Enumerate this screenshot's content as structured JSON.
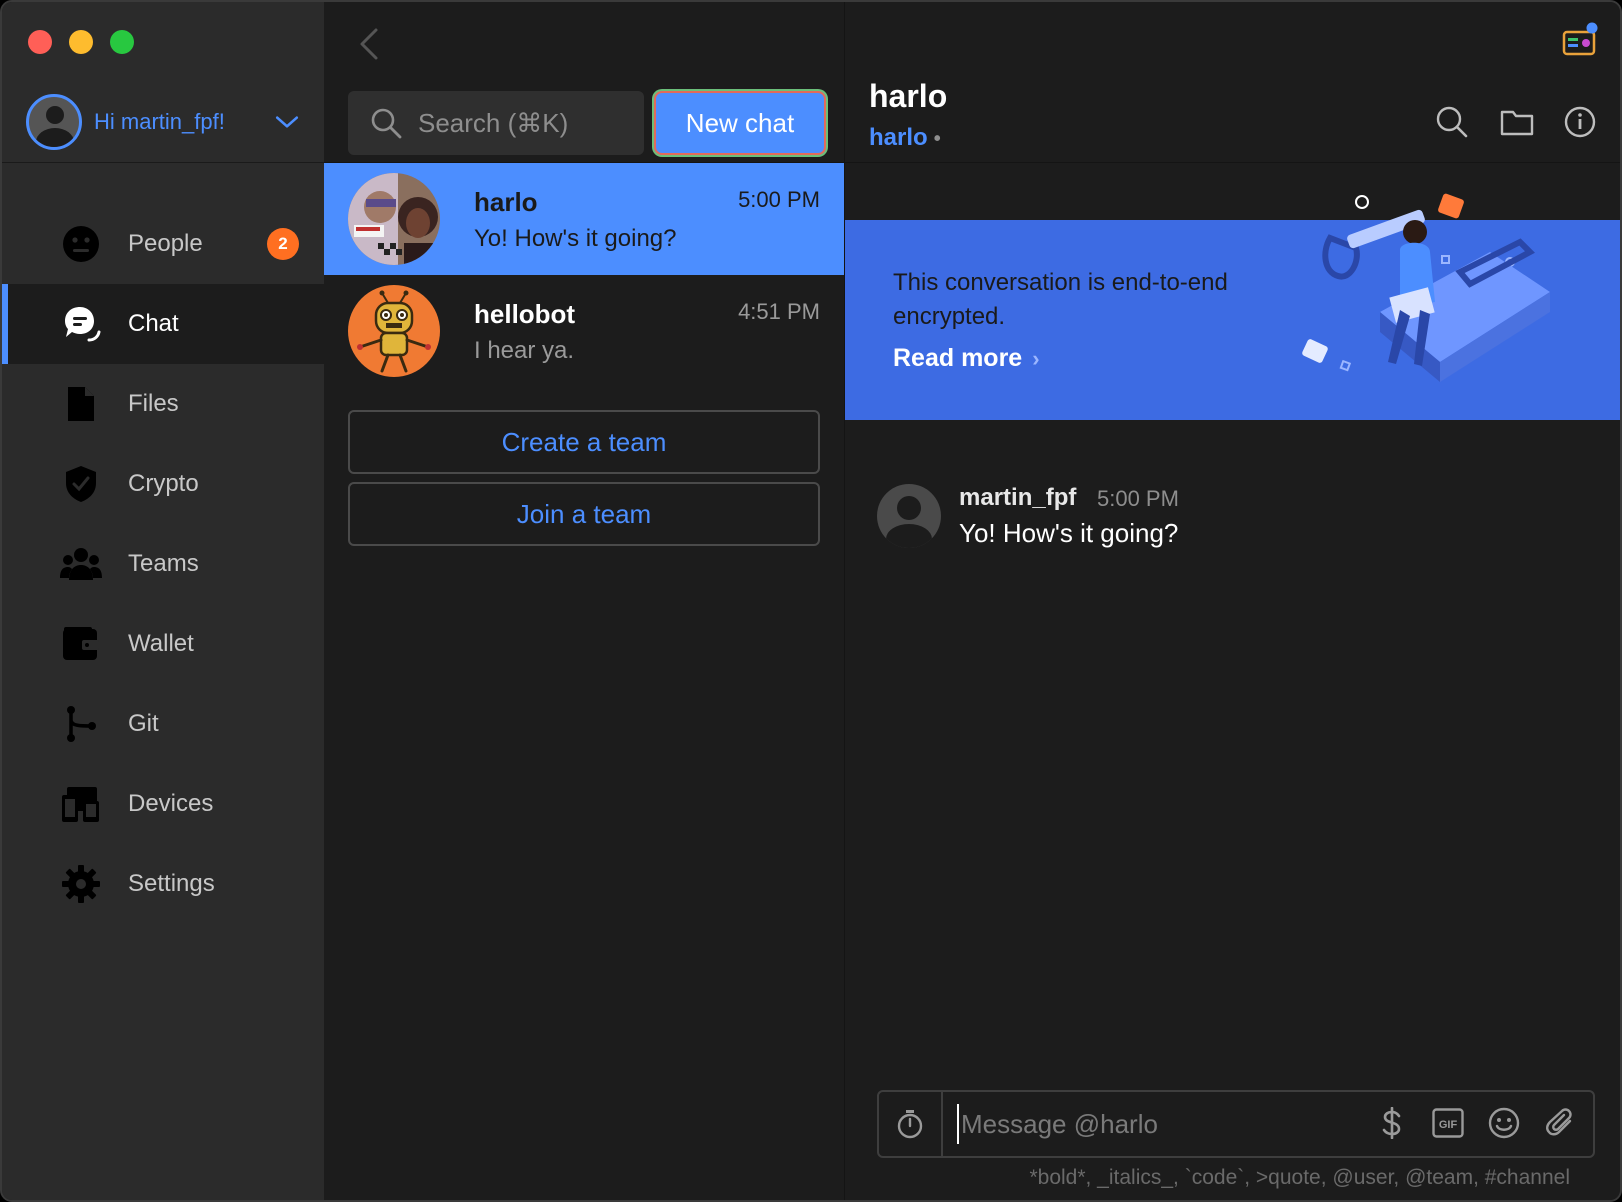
{
  "user": {
    "greeting": "Hi martin_fpf!"
  },
  "nav": [
    {
      "id": "people",
      "label": "People",
      "icon": "people-face-icon",
      "badge": "2"
    },
    {
      "id": "chat",
      "label": "Chat",
      "icon": "chat-bubble-icon",
      "active": true
    },
    {
      "id": "files",
      "label": "Files",
      "icon": "file-icon"
    },
    {
      "id": "crypto",
      "label": "Crypto",
      "icon": "shield-icon"
    },
    {
      "id": "teams",
      "label": "Teams",
      "icon": "teams-icon"
    },
    {
      "id": "wallet",
      "label": "Wallet",
      "icon": "wallet-icon"
    },
    {
      "id": "git",
      "label": "Git",
      "icon": "git-branch-icon"
    },
    {
      "id": "devices",
      "label": "Devices",
      "icon": "devices-icon"
    },
    {
      "id": "settings",
      "label": "Settings",
      "icon": "gear-icon"
    }
  ],
  "search": {
    "placeholder": "Search (⌘K)"
  },
  "new_chat_label": "New chat",
  "conversations": [
    {
      "name": "harlo",
      "time": "5:00 PM",
      "snippet": "Yo! How's it going?",
      "selected": true
    },
    {
      "name": "hellobot",
      "time": "4:51 PM",
      "snippet": "I hear ya."
    }
  ],
  "team_actions": {
    "create": "Create a team",
    "join": "Join a team"
  },
  "chat": {
    "title": "harlo",
    "subtitle": "harlo",
    "subtitle_dot": "•",
    "banner_text": "This conversation is end-to-end encrypted.",
    "banner_link": "Read more",
    "banner_link_chevron": "›",
    "message": {
      "author": "martin_fpf",
      "time": "5:00 PM",
      "text": "Yo! How's it going?"
    },
    "composer_placeholder": "Message @harlo",
    "gif_label": "GIF",
    "hint": "*bold*, _italics_, `code`, >quote, @user, @team, #channel"
  },
  "colors": {
    "accent": "#4c8eff",
    "banner": "#3d6be3",
    "badge": "#ff6f21",
    "sidebar": "#2b2b2b",
    "panel": "#1c1c1c"
  }
}
